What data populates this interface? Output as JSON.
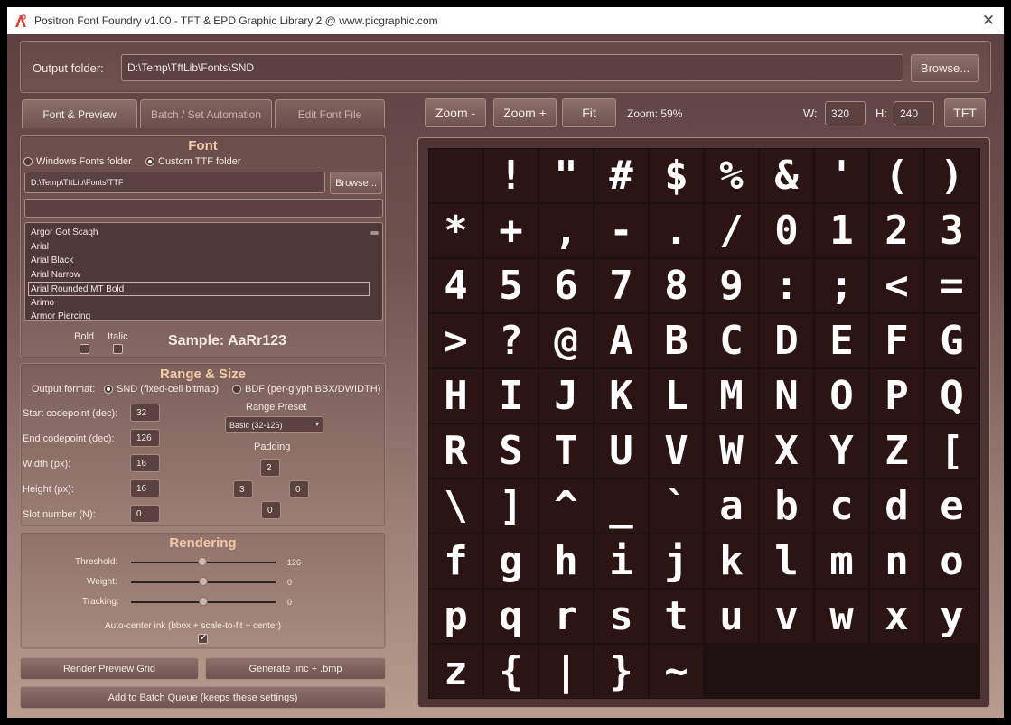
{
  "window": {
    "title": "Positron Font Foundry v1.00 - TFT & EPD Graphic Library 2 @ www.picgraphic.com",
    "close_glyph": "✕"
  },
  "output": {
    "label": "Output folder:",
    "path": "D:\\Temp\\TftLib\\Fonts\\SND",
    "browse_label": "Browse..."
  },
  "tabs": [
    {
      "label": "Font & Preview",
      "active": true
    },
    {
      "label": "Batch / Set Automation",
      "active": false
    },
    {
      "label": "Edit Font File",
      "active": false
    }
  ],
  "toolbar": {
    "zoom_out": "Zoom -",
    "zoom_in": "Zoom +",
    "fit": "Fit",
    "zoom_readout": "Zoom: 59%",
    "w_label": "W:",
    "w_value": "320",
    "h_label": "H:",
    "h_value": "240",
    "tft_label": "TFT"
  },
  "font_section": {
    "title": "Font",
    "windows_fonts": "Windows Fonts folder",
    "custom_ttf": "Custom TTF folder",
    "selected_source": "custom_ttf",
    "ttf_path": "D:\\Temp\\TftLib\\Fonts\\TTF",
    "browse_label": "Browse...",
    "search_value": "",
    "fonts": [
      "Argor Got Scaqh",
      "Arial",
      "Arial Black",
      "Arial Narrow",
      "Arial Rounded MT Bold",
      "Arimo",
      "Armor Piercing"
    ],
    "selected_font": "Arial Rounded MT Bold",
    "bold_label": "Bold",
    "italic_label": "Italic",
    "bold_checked": false,
    "italic_checked": false,
    "sample": "Sample: AaRr123"
  },
  "range_section": {
    "title": "Range & Size",
    "output_format_label": "Output format:",
    "snd_label": "SND (fixed-cell bitmap)",
    "bdf_label": "BDF (per-glyph BBX/DWIDTH)",
    "selected_format": "snd",
    "start_label": "Start codepoint (dec):",
    "start_value": "32",
    "end_label": "End codepoint (dec):",
    "end_value": "126",
    "width_label": "Width (px):",
    "width_value": "16",
    "height_label": "Height (px):",
    "height_value": "16",
    "slot_label": "Slot number (N):",
    "slot_value": "0",
    "preset_label": "Range Preset",
    "preset_value": "Basic (32-126)",
    "padding_label": "Padding",
    "pad_top": "2",
    "pad_left": "3",
    "pad_right": "0",
    "pad_bottom": "0"
  },
  "rendering": {
    "title": "Rendering",
    "threshold_label": "Threshold:",
    "threshold_value": "126",
    "threshold_level": 126,
    "weight_label": "Weight:",
    "weight_value": "0",
    "tracking_label": "Tracking:",
    "tracking_value": "0",
    "autocenter_label": "Auto-center ink (bbox + scale-to-fit + center)",
    "autocenter_checked": true
  },
  "actions": {
    "render_preview": "Render Preview Grid",
    "generate": "Generate .inc + .bmp",
    "add_batch": "Add to Batch Queue (keeps these settings)"
  },
  "glyphs": [
    "",
    "!",
    "\"",
    "#",
    "$",
    "%",
    "&",
    "'",
    "(",
    ")",
    "*",
    "+",
    ",",
    "-",
    ".",
    "/",
    "0",
    "1",
    "2",
    "3",
    "4",
    "5",
    "6",
    "7",
    "8",
    "9",
    ":",
    ";",
    "<",
    "=",
    ">",
    "?",
    "@",
    "A",
    "B",
    "C",
    "D",
    "E",
    "F",
    "G",
    "H",
    "I",
    "J",
    "K",
    "L",
    "M",
    "N",
    "O",
    "P",
    "Q",
    "R",
    "S",
    "T",
    "U",
    "V",
    "W",
    "X",
    "Y",
    "Z",
    "[",
    "\\",
    "]",
    "^",
    "_",
    "`",
    "a",
    "b",
    "c",
    "d",
    "e",
    "f",
    "g",
    "h",
    "i",
    "j",
    "k",
    "l",
    "m",
    "n",
    "o",
    "p",
    "q",
    "r",
    "s",
    "t",
    "u",
    "v",
    "w",
    "x",
    "y",
    "z",
    "{",
    "|",
    "}",
    "~"
  ]
}
